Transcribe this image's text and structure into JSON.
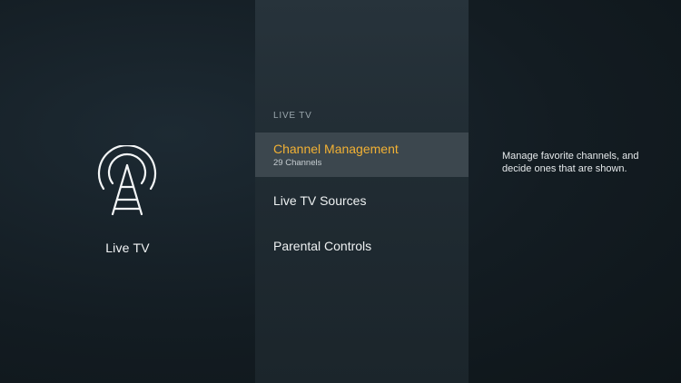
{
  "left_panel": {
    "icon": "antenna-icon",
    "title": "Live TV"
  },
  "menu": {
    "header": "LIVE TV",
    "items": [
      {
        "label": "Channel Management",
        "sublabel": "29 Channels",
        "selected": true
      },
      {
        "label": "Live TV Sources",
        "selected": false
      },
      {
        "label": "Parental Controls",
        "selected": false
      }
    ]
  },
  "description": {
    "text": "Manage favorite channels, and decide ones that are shown."
  },
  "colors": {
    "accent": "#f2b134",
    "selection_bg": "#3c474e",
    "menu_bg": "#222d34",
    "background": "#131c22"
  }
}
